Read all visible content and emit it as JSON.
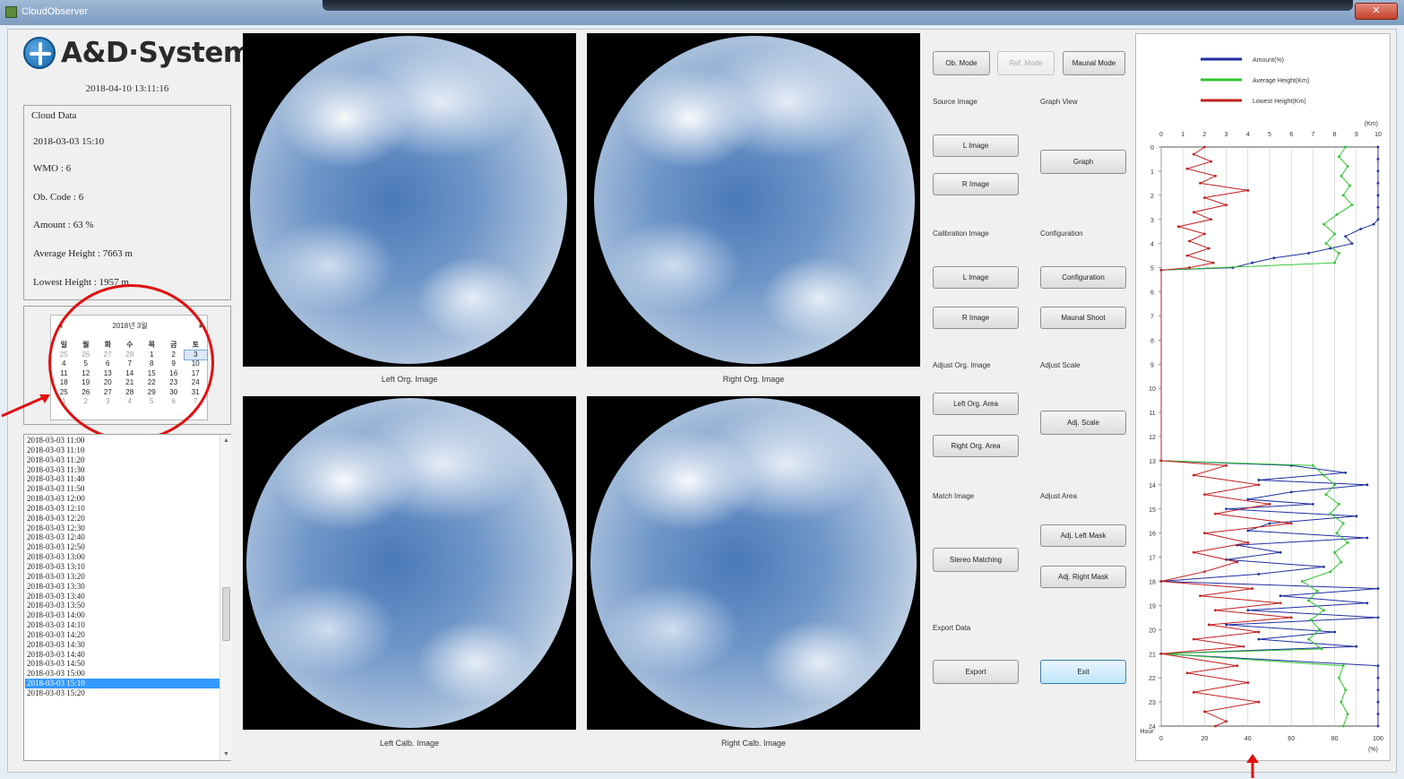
{
  "window": {
    "title": "CloudObserver",
    "close_label": "✕"
  },
  "logo": {
    "text": "A&D·System"
  },
  "datetime": "2018-04-10 13:11:16",
  "cloud_data": {
    "title": "Cloud Data",
    "lines": [
      "2018-03-03 15:10",
      "WMO : 6",
      "Ob. Code : 6",
      "Amount : 63 %",
      "Average Height : 7663 m",
      "Lowest Height : 1957 m"
    ]
  },
  "calendar": {
    "header": "2018년 3월",
    "prev": "◄",
    "next": "►",
    "weekdays": [
      "일",
      "월",
      "화",
      "수",
      "목",
      "금",
      "토"
    ],
    "days": [
      [
        "25",
        "26",
        "27",
        "28",
        "1",
        "2",
        "3"
      ],
      [
        "4",
        "5",
        "6",
        "7",
        "8",
        "9",
        "10"
      ],
      [
        "11",
        "12",
        "13",
        "14",
        "15",
        "16",
        "17"
      ],
      [
        "18",
        "19",
        "20",
        "21",
        "22",
        "23",
        "24"
      ],
      [
        "25",
        "26",
        "27",
        "28",
        "29",
        "30",
        "31"
      ],
      [
        "1",
        "2",
        "3",
        "4",
        "5",
        "6",
        "7"
      ]
    ]
  },
  "time_list": {
    "items": [
      "2018-03-03 11:00",
      "2018-03-03 11:10",
      "2018-03-03 11:20",
      "2018-03-03 11:30",
      "2018-03-03 11:40",
      "2018-03-03 11:50",
      "2018-03-03 12:00",
      "2018-03-03 12:10",
      "2018-03-03 12:20",
      "2018-03-03 12:30",
      "2018-03-03 12:40",
      "2018-03-03 12:50",
      "2018-03-03 13:00",
      "2018-03-03 13:10",
      "2018-03-03 13:20",
      "2018-03-03 13:30",
      "2018-03-03 13:40",
      "2018-03-03 13:50",
      "2018-03-03 14:00",
      "2018-03-03 14:10",
      "2018-03-03 14:20",
      "2018-03-03 14:30",
      "2018-03-03 14:40",
      "2018-03-03 14:50",
      "2018-03-03 15:00",
      "2018-03-03 15:10",
      "2018-03-03 15:20"
    ],
    "selected_index": 25
  },
  "images": {
    "top_left_caption": "Left Org. Image",
    "top_right_caption": "Right Org. Image",
    "bottom_left_caption": "Left Calb. Image",
    "bottom_right_caption": "Right Calb. Image"
  },
  "controls": {
    "ob_mode": "Ob. Mode",
    "ref_mode": "Ref. Mode",
    "manual_mode": "Maunal Mode",
    "source_image": "Source Image",
    "graph_view": "Graph View",
    "l_image": "L Image",
    "r_image": "R Image",
    "graph": "Graph",
    "calibration_image": "Calibration Image",
    "configuration_label": "Configuration",
    "cal_l_image": "L Image",
    "cal_r_image": "R Image",
    "configuration": "Configuration",
    "manual_shoot": "Maunal Shoot",
    "adjust_org_image": "Adjust Org. Image",
    "adjust_scale": "Adjust Scale",
    "left_org_area": "Left Org. Area",
    "right_org_area": "Right Org. Area",
    "adj_scale": "Adj. Scale",
    "match_image": "Match Image",
    "adjust_area": "Adjust Area",
    "adj_left_mask": "Adj. Left Mask",
    "adj_right_mask": "Adj. Right Mask",
    "stereo_matching": "Stereo Matching",
    "export_data": "Export Data",
    "export": "Export",
    "exit": "Exit"
  },
  "chart_data": {
    "type": "line",
    "legend": [
      {
        "name": "Amount(%)",
        "color": "#1f2fa0"
      },
      {
        "name": "Average Height(Km)",
        "color": "#2fc42f"
      },
      {
        "name": "Lowest Height(Km)",
        "color": "#c21f1f"
      }
    ],
    "top_axis": {
      "unit": "(Km)",
      "ticks": [
        "0",
        "1",
        "2",
        "3",
        "4",
        "5",
        "6",
        "7",
        "8",
        "9",
        "10"
      ],
      "range": [
        0,
        10
      ]
    },
    "bottom_axis": {
      "unit": "(%)",
      "ticks": [
        "0",
        "20",
        "40",
        "60",
        "80",
        "100"
      ],
      "range": [
        0,
        100
      ]
    },
    "y_axis": {
      "unit": "Hour",
      "ticks": [
        "0",
        "1",
        "2",
        "3",
        "4",
        "5",
        "6",
        "7",
        "8",
        "9",
        "10",
        "11",
        "12",
        "13",
        "14",
        "15",
        "16",
        "17",
        "18",
        "19",
        "20",
        "21",
        "22",
        "23",
        "24"
      ],
      "range": [
        0,
        24
      ]
    },
    "series": [
      {
        "name": "Amount(%)",
        "axis": "percent",
        "points": [
          [
            0,
            100
          ],
          [
            0.5,
            100
          ],
          [
            1,
            100
          ],
          [
            1.5,
            100
          ],
          [
            2,
            100
          ],
          [
            2.5,
            100
          ],
          [
            3,
            100
          ],
          [
            3.2,
            98
          ],
          [
            3.4,
            92
          ],
          [
            3.7,
            85
          ],
          [
            4,
            88
          ],
          [
            4.2,
            78
          ],
          [
            4.4,
            68
          ],
          [
            4.6,
            52
          ],
          [
            4.8,
            42
          ],
          [
            5,
            33
          ],
          [
            5.1,
            0
          ],
          [
            13.0,
            0
          ],
          [
            13.2,
            60
          ],
          [
            13.5,
            85
          ],
          [
            13.8,
            45
          ],
          [
            14.0,
            95
          ],
          [
            14.3,
            60
          ],
          [
            14.6,
            40
          ],
          [
            14.8,
            70
          ],
          [
            15.0,
            30
          ],
          [
            15.3,
            90
          ],
          [
            15.6,
            50
          ],
          [
            15.9,
            40
          ],
          [
            16.2,
            95
          ],
          [
            16.5,
            35
          ],
          [
            16.8,
            55
          ],
          [
            17.1,
            30
          ],
          [
            17.4,
            75
          ],
          [
            17.7,
            45
          ],
          [
            18.0,
            0
          ],
          [
            18.3,
            100
          ],
          [
            18.6,
            55
          ],
          [
            18.9,
            95
          ],
          [
            19.2,
            40
          ],
          [
            19.5,
            100
          ],
          [
            19.8,
            30
          ],
          [
            20.1,
            80
          ],
          [
            20.4,
            45
          ],
          [
            20.7,
            90
          ],
          [
            21.0,
            0
          ],
          [
            21.5,
            100
          ],
          [
            22,
            100
          ],
          [
            22.5,
            100
          ],
          [
            23,
            100
          ],
          [
            23.5,
            100
          ],
          [
            24,
            100
          ]
        ]
      },
      {
        "name": "Average Height(Km)",
        "axis": "km",
        "points": [
          [
            0,
            8.5
          ],
          [
            0.4,
            8.2
          ],
          [
            0.8,
            8.6
          ],
          [
            1.2,
            8.3
          ],
          [
            1.6,
            8.7
          ],
          [
            2,
            8.4
          ],
          [
            2.4,
            8.8
          ],
          [
            2.8,
            8.1
          ],
          [
            3.2,
            7.5
          ],
          [
            3.6,
            8.0
          ],
          [
            4,
            7.6
          ],
          [
            4.4,
            8.2
          ],
          [
            4.8,
            8.0
          ],
          [
            5.1,
            0
          ],
          [
            13.0,
            0
          ],
          [
            13.2,
            7.0
          ],
          [
            13.6,
            7.5
          ],
          [
            14.0,
            8.0
          ],
          [
            14.4,
            7.6
          ],
          [
            14.8,
            8.2
          ],
          [
            15.2,
            7.8
          ],
          [
            15.6,
            8.4
          ],
          [
            16.0,
            8.1
          ],
          [
            16.4,
            8.6
          ],
          [
            16.8,
            8.0
          ],
          [
            17.2,
            8.3
          ],
          [
            17.6,
            7.8
          ],
          [
            18.0,
            6.5
          ],
          [
            18.4,
            7.2
          ],
          [
            18.8,
            6.8
          ],
          [
            19.2,
            7.5
          ],
          [
            19.6,
            6.9
          ],
          [
            20.0,
            7.3
          ],
          [
            20.4,
            6.8
          ],
          [
            20.8,
            7.4
          ],
          [
            21.0,
            0
          ],
          [
            21.5,
            8.4
          ],
          [
            22,
            8.2
          ],
          [
            22.5,
            8.5
          ],
          [
            23,
            8.3
          ],
          [
            23.5,
            8.6
          ],
          [
            24,
            8.4
          ]
        ]
      },
      {
        "name": "Lowest Height(Km)",
        "axis": "km",
        "points": [
          [
            0,
            2.0
          ],
          [
            0.3,
            1.5
          ],
          [
            0.6,
            2.3
          ],
          [
            0.9,
            1.2
          ],
          [
            1.2,
            2.5
          ],
          [
            1.5,
            1.8
          ],
          [
            1.8,
            4.0
          ],
          [
            2.1,
            2.0
          ],
          [
            2.4,
            3.0
          ],
          [
            2.7,
            1.5
          ],
          [
            3.0,
            2.3
          ],
          [
            3.3,
            0.8
          ],
          [
            3.6,
            2.0
          ],
          [
            3.9,
            1.3
          ],
          [
            4.2,
            2.2
          ],
          [
            4.5,
            1.2
          ],
          [
            4.8,
            2.4
          ],
          [
            5.0,
            1.3
          ],
          [
            5.1,
            0
          ],
          [
            13.0,
            0
          ],
          [
            13.2,
            3.0
          ],
          [
            13.6,
            1.5
          ],
          [
            14.0,
            4.5
          ],
          [
            14.4,
            2.0
          ],
          [
            14.8,
            5.0
          ],
          [
            15.2,
            2.5
          ],
          [
            15.6,
            6.0
          ],
          [
            16.0,
            2.0
          ],
          [
            16.4,
            4.0
          ],
          [
            16.8,
            1.5
          ],
          [
            17.2,
            3.5
          ],
          [
            17.6,
            2.0
          ],
          [
            18.0,
            0
          ],
          [
            18.3,
            4.2
          ],
          [
            18.6,
            1.8
          ],
          [
            18.9,
            5.5
          ],
          [
            19.2,
            2.5
          ],
          [
            19.5,
            6.0
          ],
          [
            19.8,
            2.2
          ],
          [
            20.1,
            4.5
          ],
          [
            20.4,
            1.5
          ],
          [
            20.7,
            3.8
          ],
          [
            21.0,
            0
          ],
          [
            21.5,
            3.5
          ],
          [
            21.8,
            1.2
          ],
          [
            22.2,
            4.0
          ],
          [
            22.6,
            1.5
          ],
          [
            23.0,
            4.5
          ],
          [
            23.4,
            2.0
          ],
          [
            23.8,
            3.0
          ],
          [
            24,
            2.5
          ]
        ]
      }
    ]
  }
}
